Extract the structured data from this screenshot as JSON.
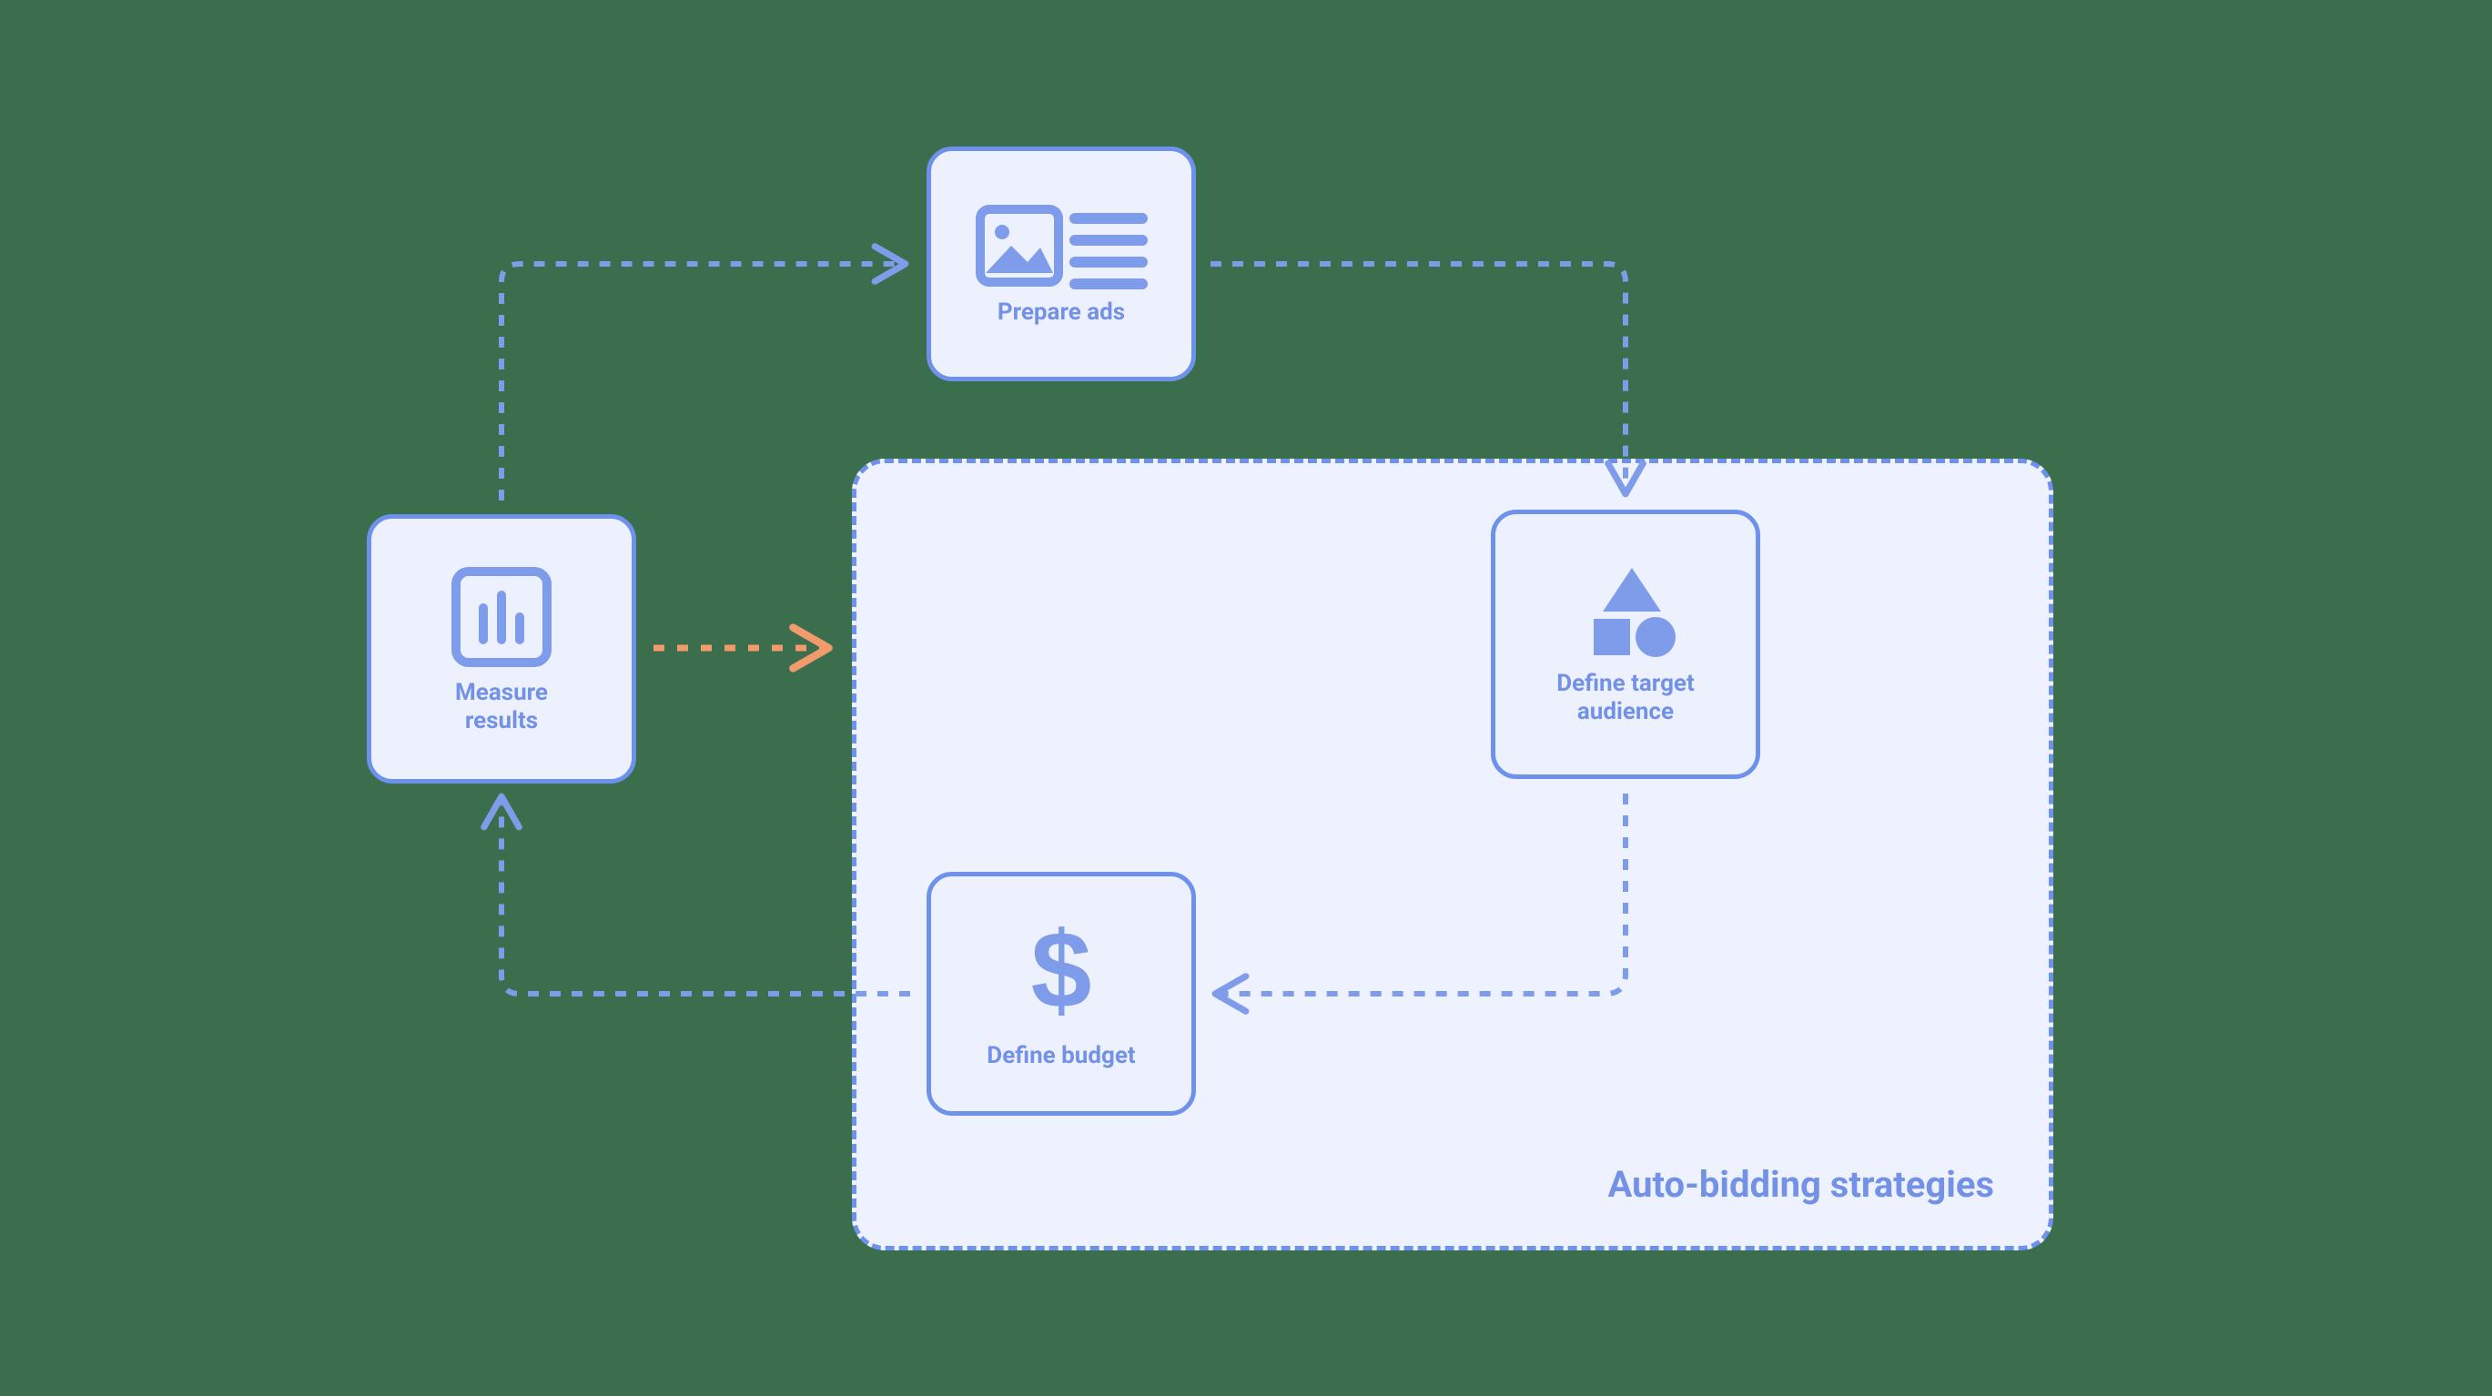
{
  "nodes": {
    "measure_results": {
      "label": "Measure results"
    },
    "prepare_ads": {
      "label": "Prepare ads"
    },
    "define_target_audience": {
      "label": "Define target audience"
    },
    "define_budget": {
      "label": "Define budget"
    }
  },
  "group": {
    "label": "Auto-bidding strategies"
  },
  "icons": {
    "bar_chart": "bar-chart-icon",
    "image_lines": "image-lines-icon",
    "shapes": "shapes-icon",
    "dollar": "dollar-icon"
  },
  "colors": {
    "background": "#3b6e4c",
    "node_fill": "#edf1fe",
    "node_border": "#6e91ec",
    "text": "#7391e6",
    "accent_arrow": "#f39a6d"
  },
  "connectors": [
    {
      "from": "measure_results",
      "to": "prepare_ads",
      "color": "blue"
    },
    {
      "from": "measure_results",
      "to": "group",
      "color": "orange"
    },
    {
      "from": "prepare_ads",
      "to": "define_target_audience",
      "color": "blue"
    },
    {
      "from": "define_target_audience",
      "to": "define_budget",
      "color": "blue"
    },
    {
      "from": "define_budget",
      "to": "measure_results",
      "color": "blue"
    }
  ]
}
